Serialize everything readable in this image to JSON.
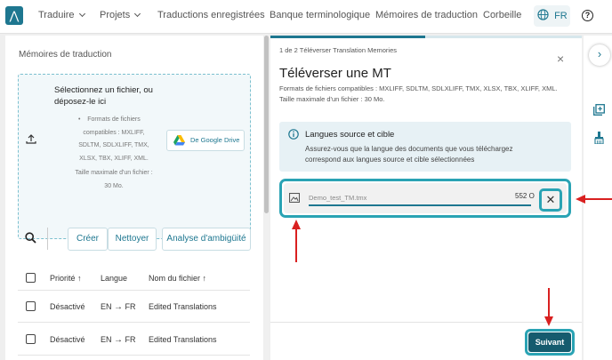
{
  "nav": {
    "items": [
      {
        "label": "Traduire",
        "dropdown": true
      },
      {
        "label": "Projets",
        "dropdown": true
      },
      {
        "label": "Traductions enregistrées"
      },
      {
        "label": "Banque terminologique"
      },
      {
        "label": "Mémoires de traduction"
      },
      {
        "label": "Corbeille"
      }
    ],
    "language": "FR"
  },
  "left": {
    "title": "Mémoires de traduction",
    "upload": {
      "heading": "Sélectionnez un fichier, ou déposez-le ici",
      "formats": "Formats de fichiers compatibles : MXLIFF, SDLTM, SDLXLIFF, TMX, XLSX, TBX, XLIFF, XML.",
      "size": "Taille maximale d'un fichier : 30 Mo.",
      "google_drive": "De Google Drive"
    },
    "toolbar": {
      "create": "Créer",
      "clean": "Nettoyer",
      "ambiguity": "Analyse d'ambigüité"
    },
    "table": {
      "headers": {
        "priority": "Priorité",
        "language": "Langue",
        "filename": "Nom du fichier"
      },
      "rows": [
        {
          "priority": "Désactivé",
          "source": "EN",
          "target": "FR",
          "filename": "Edited Translations"
        },
        {
          "priority": "Désactivé",
          "source": "EN",
          "target": "FR",
          "filename": "Edited Translations"
        }
      ]
    }
  },
  "modal": {
    "step": "1 de 2 Téléverser Translation Memories",
    "title": "Téléverser une MT",
    "formats": "Formats de fichiers compatibles : MXLIFF, SDLTM, SDLXLIFF, TMX, XLSX, TBX, XLIFF, XML. Taille maximale d'un fichier : 30 Mo.",
    "info": {
      "title": "Langues source et cible",
      "body": "Assurez-vous que la langue des documents que vous téléchargez correspond aux langues source et cible sélectionnées"
    },
    "file": {
      "name": "Demo_test_TM.tmx",
      "size": "552 O",
      "progress": 1.0
    },
    "next": "Suivant"
  },
  "colors": {
    "accent": "#1e7790",
    "highlight": "#2aa3b4",
    "annotation": "#d92020"
  }
}
